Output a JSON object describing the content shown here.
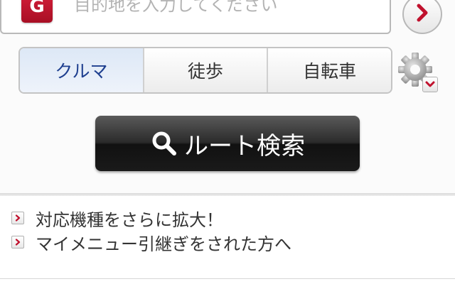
{
  "destination": {
    "goal_badge": "G",
    "placeholder": "目的地を入力してください",
    "value": ""
  },
  "go_button_icon": "chevron-right-icon",
  "mode_tabs": [
    {
      "label": "クルマ",
      "selected": true
    },
    {
      "label": "徒歩",
      "selected": false
    },
    {
      "label": "自転車",
      "selected": false
    }
  ],
  "settings_icon": "gear-icon",
  "route_search": {
    "label": "ルート検索",
    "icon": "search-icon"
  },
  "links": [
    {
      "label": "対応機種をさらに拡大！"
    },
    {
      "label": "マイメニュー引継ぎをされた方へ"
    }
  ],
  "colors": {
    "accent_red": "#c0122e",
    "selected_tab_text": "#1e3f8f",
    "route_button_bg": "#1a1a1a"
  }
}
